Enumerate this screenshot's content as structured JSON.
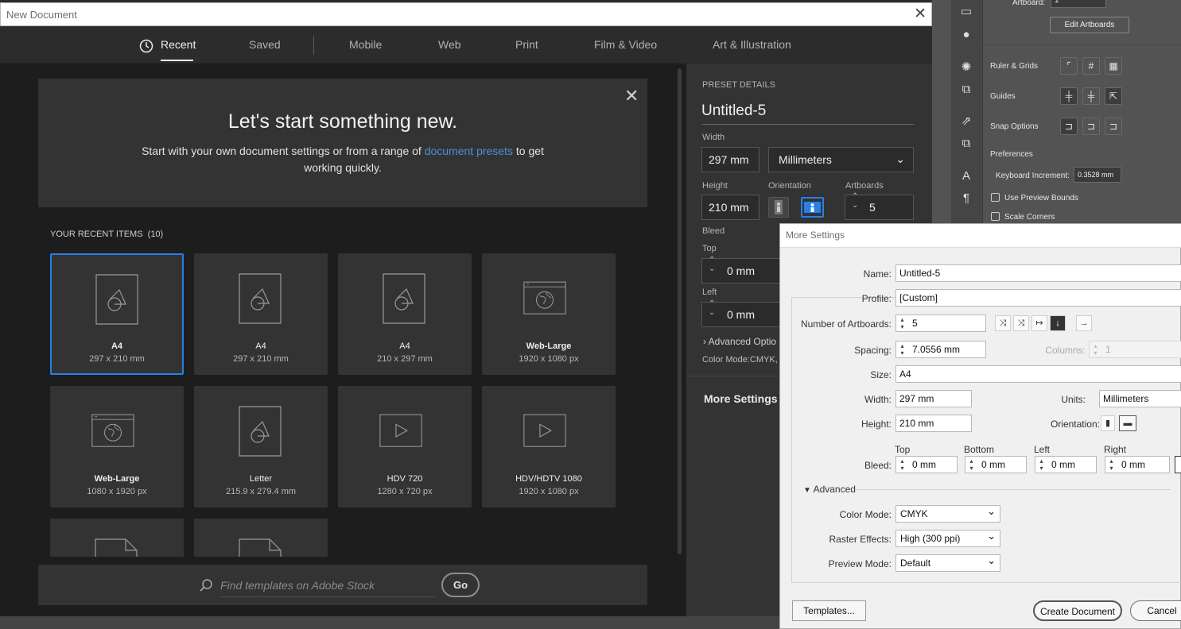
{
  "new_document": {
    "title": "New Document",
    "tabs": [
      "Recent",
      "Saved",
      "Mobile",
      "Web",
      "Print",
      "Film & Video",
      "Art & Illustration"
    ],
    "active_tab": "Recent",
    "hero": {
      "heading": "Let's start something new.",
      "text_before": "Start with your own document settings or from a range of",
      "link": "document presets",
      "text_after": "to get working quickly."
    },
    "recent_label": "YOUR RECENT ITEMS",
    "recent_count": "(10)",
    "items": [
      {
        "name": "A4",
        "size": "297 x 210 mm",
        "icon": "document-icon"
      },
      {
        "name": "A4",
        "size": "297 x 210 mm",
        "icon": "document-icon"
      },
      {
        "name": "A4",
        "size": "210 x 297 mm",
        "icon": "document-icon"
      },
      {
        "name": "Web-Large",
        "size": "1920 x 1080 px",
        "icon": "web-icon"
      },
      {
        "name": "Web-Large",
        "size": "1080 x 1920 px",
        "icon": "web-icon"
      },
      {
        "name": "Letter",
        "size": "215.9 x 279.4 mm",
        "icon": "document-icon"
      },
      {
        "name": "HDV 720",
        "size": "1280 x 720 px",
        "icon": "video-icon"
      },
      {
        "name": "HDV/HDTV 1080",
        "size": "1920 x 1080 px",
        "icon": "video-icon"
      }
    ],
    "search_placeholder": "Find templates on Adobe Stock",
    "go_label": "Go"
  },
  "preset": {
    "section": "PRESET DETAILS",
    "name": "Untitled-5",
    "width_label": "Width",
    "width": "297 mm",
    "units": "Millimeters",
    "height_label": "Height",
    "height": "210 mm",
    "orientation_label": "Orientation",
    "artboards_label": "Artboards",
    "artboards": "5",
    "bleed_label": "Bleed",
    "top_label": "Top",
    "top": "0 mm",
    "left_label": "Left",
    "left": "0 mm",
    "advanced_label": "Advanced Optio",
    "color_mode": "Color Mode:CMYK, I",
    "more_settings": "More Settings"
  },
  "properties": {
    "artboard_label": "Artboard:",
    "artboard_value": "1",
    "edit_artboards": "Edit Artboards",
    "ruler_grids": "Ruler & Grids",
    "guides": "Guides",
    "snap_options": "Snap Options",
    "preferences": "Preferences",
    "keyboard_increment_label": "Keyboard Increment:",
    "keyboard_increment": "0.3528 mm",
    "use_preview_bounds": "Use Preview Bounds",
    "scale_corners": "Scale Corners"
  },
  "more_settings": {
    "title": "More Settings",
    "name_label": "Name:",
    "name": "Untitled-5",
    "profile_label": "Profile:",
    "profile": "[Custom]",
    "artboards_label": "Number of Artboards:",
    "artboards": "5",
    "spacing_label": "Spacing:",
    "spacing": "7.0556 mm",
    "columns_label": "Columns:",
    "columns": "1",
    "size_label": "Size:",
    "size": "A4",
    "width_label": "Width:",
    "width": "297 mm",
    "units_label": "Units:",
    "units": "Millimeters",
    "height_label": "Height:",
    "height": "210 mm",
    "orientation_label": "Orientation:",
    "bleed_label": "Bleed:",
    "bleed_top_label": "Top",
    "bleed_bottom_label": "Bottom",
    "bleed_left_label": "Left",
    "bleed_right_label": "Right",
    "bleed_top": "0 mm",
    "bleed_bottom": "0 mm",
    "bleed_left": "0 mm",
    "bleed_right": "0 mm",
    "advanced_label": "Advanced",
    "color_mode_label": "Color Mode:",
    "color_mode": "CMYK",
    "raster_label": "Raster Effects:",
    "raster": "High (300 ppi)",
    "preview_label": "Preview Mode:",
    "preview": "Default",
    "templates_button": "Templates...",
    "create_button": "Create Document",
    "cancel_button": "Cancel"
  },
  "colors": {
    "accent": "#2680eb",
    "link": "#4a90d9",
    "dialog_bg": "#2c2c2c",
    "card_bg": "#333333"
  }
}
